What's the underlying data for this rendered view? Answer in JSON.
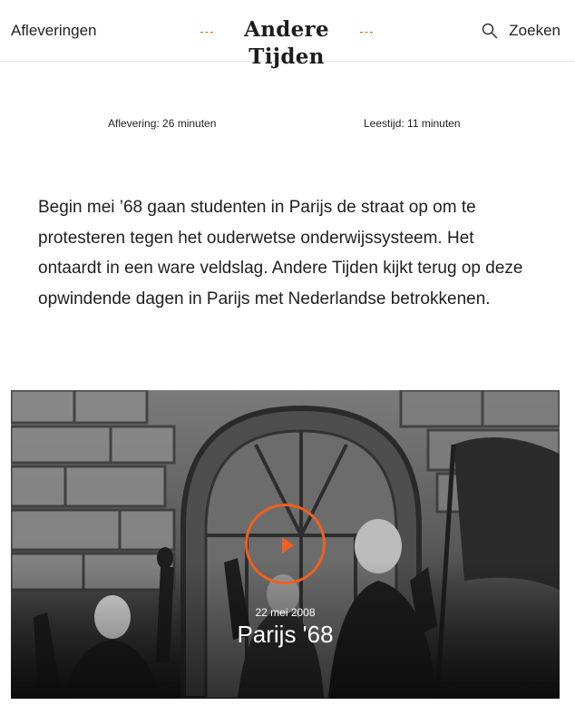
{
  "header": {
    "nav_label": "Afleveringen",
    "logo_text": "Andere Tijden",
    "search_label": "Zoeken",
    "search_icon": "search-icon",
    "accent_color": "#e8561d"
  },
  "meta": {
    "episode_length": "Aflevering: 26 minuten",
    "reading_time": "Leestijd: 11 minuten"
  },
  "intro": {
    "text": "Begin mei ’68 gaan studenten in Parijs de straat op om te protesteren tegen het ouderwetse onderwijssysteem. Het ontaardt in een ware veldslag. Andere Tijden kijkt terug op deze opwindende dagen in Parijs met Nederlandse betrokkenen."
  },
  "video": {
    "date": "22 mei 2008",
    "title": "Parijs '68",
    "play_icon": "play-icon",
    "accent_color": "#f0601e"
  }
}
